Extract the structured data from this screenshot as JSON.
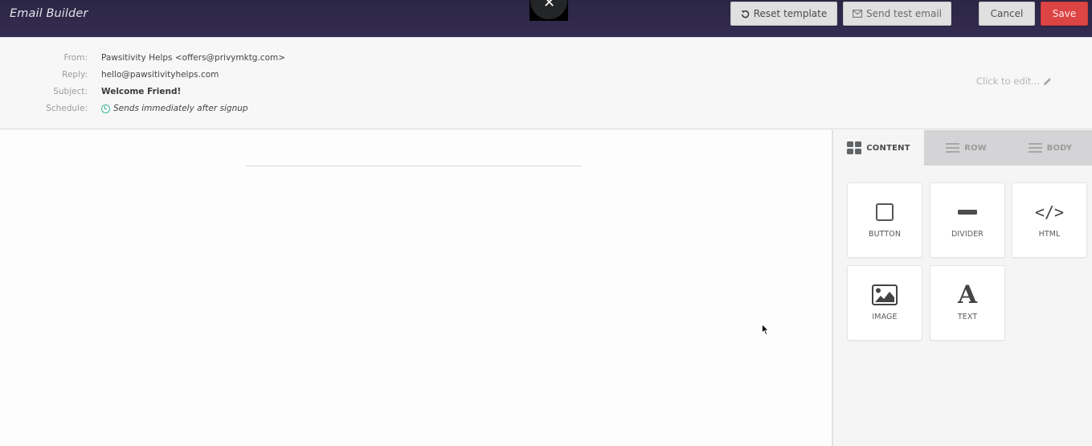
{
  "app": {
    "title": "Email Builder"
  },
  "toolbar": {
    "close_label": "✕",
    "reset_label": "Reset template",
    "send_test_label": "Send test email",
    "cancel_label": "Cancel",
    "save_label": "Save",
    "colors": {
      "save": "#dd4444",
      "header": "#2f2849"
    }
  },
  "email_meta": {
    "from_label": "From:",
    "from_value": "Pawsitivity Helps <offers@privymktg.com>",
    "reply_label": "Reply:",
    "reply_value": "hello@pawsitivityhelps.com",
    "subject_label": "Subject:",
    "subject_value": "Welcome Friend!",
    "schedule_label": "Schedule:",
    "schedule_value": "Sends immediately after signup",
    "edit_label": "Click to edit..."
  },
  "panel": {
    "tabs": [
      {
        "label": "CONTENT",
        "icon": "grid-icon",
        "active": true
      },
      {
        "label": "ROW",
        "icon": "lines-icon",
        "active": false
      },
      {
        "label": "BODY",
        "icon": "lines-icon",
        "active": false
      }
    ],
    "blocks": [
      {
        "label": "BUTTON",
        "icon": "button-icon"
      },
      {
        "label": "DIVIDER",
        "icon": "divider-icon"
      },
      {
        "label": "HTML",
        "icon": "code-icon",
        "glyph": "</>"
      },
      {
        "label": "IMAGE",
        "icon": "image-icon"
      },
      {
        "label": "TEXT",
        "icon": "text-icon",
        "glyph": "A"
      }
    ]
  }
}
